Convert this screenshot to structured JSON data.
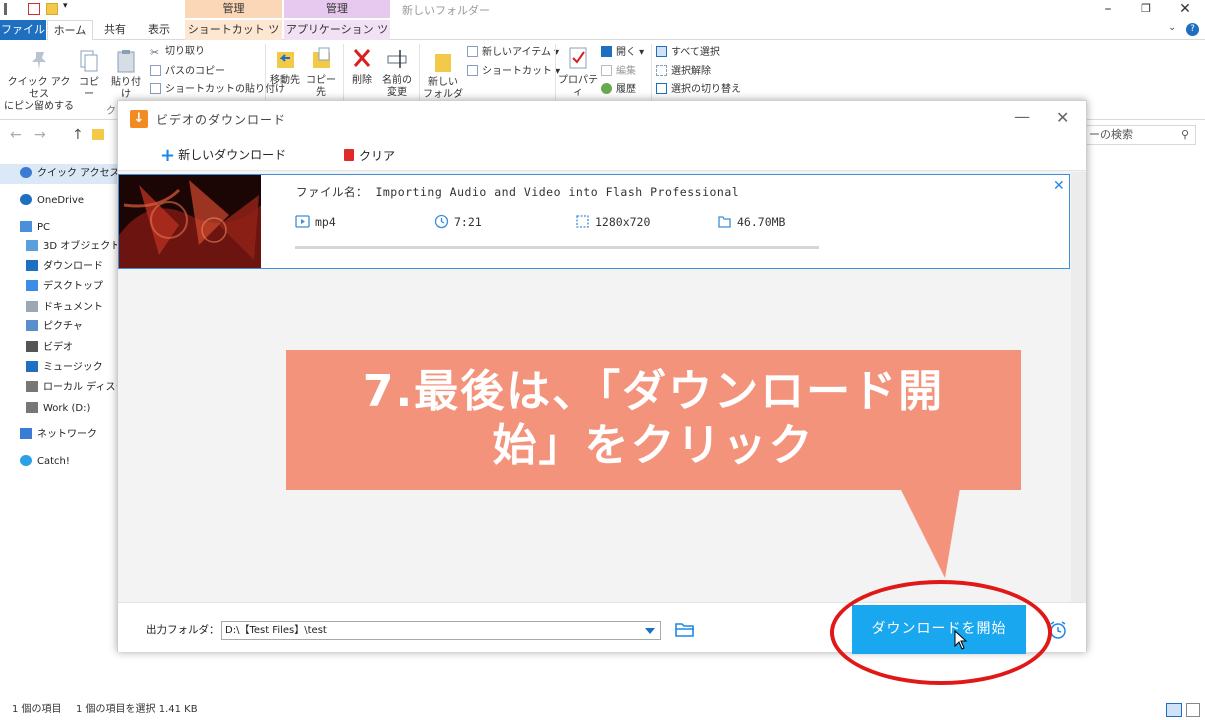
{
  "explorer": {
    "window_title": "新しいフォルダー",
    "context_tab_manage_1": "管理",
    "context_tab_manage_2": "管理",
    "tabs": [
      "ファイル",
      "ホーム",
      "共有",
      "表示",
      "ショートカット ツール",
      "アプリケーション ツール"
    ],
    "ribbon": {
      "pin_quick_access": [
        "クイック アクセス",
        "にピン留めする"
      ],
      "copy": "コピー",
      "paste": "貼り付け",
      "cut": "切り取り",
      "copy_path": "パスのコピー",
      "paste_shortcut": "ショートカットの貼り付け",
      "move_to": "移動先",
      "copy_to": "コピー先",
      "delete": "削除",
      "rename": [
        "名前の",
        "変更"
      ],
      "new_folder": [
        "新しい",
        "フォルダー"
      ],
      "new_item": "新しいアイテム",
      "shortcut": "ショートカット",
      "properties": "プロパティ",
      "open": "開く",
      "edit": "編集",
      "history": "履歴",
      "select_all": "すべて選択",
      "select_none": "選択解除",
      "invert_selection": "選択の切り替え",
      "group_fragment": "ク"
    },
    "search_placeholder": "ーの検索",
    "nav": [
      {
        "label": "クイック アクセス",
        "icon": "star-icon",
        "selected": true
      },
      {
        "label": "OneDrive",
        "icon": "cloud-icon"
      },
      {
        "label": "PC",
        "icon": "computer-icon"
      },
      {
        "label": "3D オブジェクト",
        "icon": "cube-icon"
      },
      {
        "label": "ダウンロード",
        "icon": "download-arrow-icon"
      },
      {
        "label": "デスクトップ",
        "icon": "desktop-icon"
      },
      {
        "label": "ドキュメント",
        "icon": "document-icon"
      },
      {
        "label": "ピクチャ",
        "icon": "picture-icon"
      },
      {
        "label": "ビデオ",
        "icon": "video-icon"
      },
      {
        "label": "ミュージック",
        "icon": "music-icon"
      },
      {
        "label": "ローカル ディスク (C",
        "icon": "drive-icon"
      },
      {
        "label": "Work (D:)",
        "icon": "drive-icon"
      },
      {
        "label": "ネットワーク",
        "icon": "network-icon"
      },
      {
        "label": "Catch!",
        "icon": "catch-app-icon"
      }
    ],
    "status_items": "1 個の項目",
    "status_selected": "1 個の項目を選択  1.41 KB"
  },
  "dialog": {
    "title": "ビデオのダウンロード",
    "new_download": "新しいダウンロード",
    "clear": "クリア",
    "item": {
      "filename_label": "ファイル名：",
      "filename": "Importing Audio and Video into Flash Professional",
      "format": "mp4",
      "duration": "7:21",
      "resolution": "1280x720",
      "size": "46.70MB",
      "progress": 0
    },
    "output_label": "出力フォルダ：",
    "output_path": "D:\\【Test Files】\\test",
    "start_button": "ダウンロードを開始"
  },
  "annotation": {
    "line1": "7.最後は、「ダウンロード開",
    "line2": "始」をクリック",
    "callout_color": "#f4937c",
    "circle_color": "#e01818"
  },
  "colors": {
    "accent_blue": "#1e6fc0",
    "start_button": "#19a7ef",
    "card_border": "#3d8ed6"
  }
}
